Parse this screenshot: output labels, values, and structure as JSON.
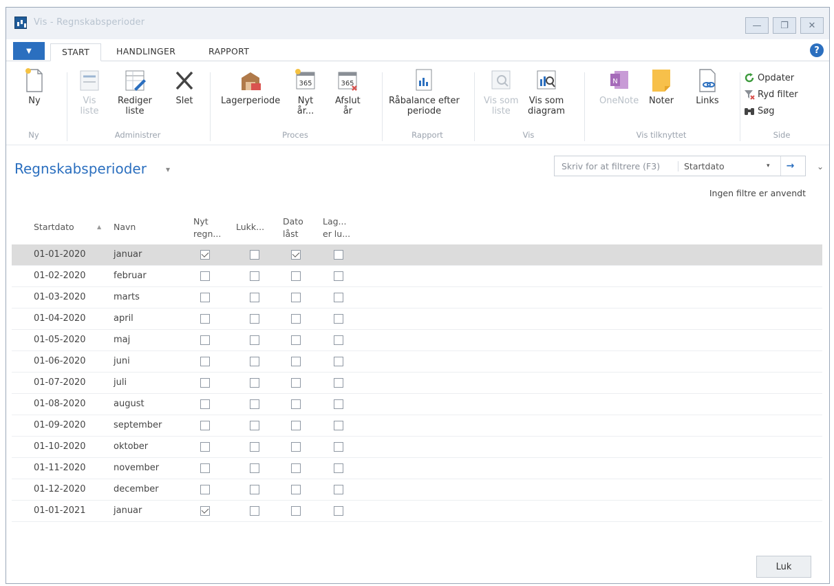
{
  "window": {
    "title": "Vis - Regnskabsperioder"
  },
  "win_controls": {
    "minimize": "—",
    "maximize": "❐",
    "close": "✕"
  },
  "ribbon_tabs": [
    "START",
    "HANDLINGER",
    "RAPPORT"
  ],
  "help_label": "?",
  "ribbon": {
    "groups": {
      "ny": "Ny",
      "administrer": "Administrer",
      "proces": "Proces",
      "rapport": "Rapport",
      "vis": "Vis",
      "vis_tilknyttet": "Vis tilknyttet",
      "side": "Side"
    },
    "buttons": {
      "ny": "Ny",
      "vis_liste_1": "Vis",
      "vis_liste_2": "liste",
      "rediger_1": "Rediger",
      "rediger_2": "liste",
      "slet": "Slet",
      "lagerperiode": "Lagerperiode",
      "nyt_aar_1": "Nyt",
      "nyt_aar_2": "år...",
      "afslut_1": "Afslut",
      "afslut_2": "år",
      "raabalance_1": "Råbalance efter",
      "raabalance_2": "periode",
      "vis_som_liste_1": "Vis som",
      "vis_som_liste_2": "liste",
      "vis_som_diagram_1": "Vis som",
      "vis_som_diagram_2": "diagram",
      "onenote": "OneNote",
      "noter": "Noter",
      "links": "Links",
      "opdater": "Opdater",
      "ryd_filter": "Ryd filter",
      "soeg": "Søg"
    },
    "icon_365": "365"
  },
  "page": {
    "title": "Regnskabsperioder",
    "title_caret": "▾",
    "filter_placeholder": "Skriv for at filtrere (F3)",
    "filter_field": "Startdato",
    "filter_drop": "▾",
    "filter_go": "→",
    "collapse": "⌄",
    "filter_status": "Ingen filtre er anvendt"
  },
  "table": {
    "headers": {
      "startdato": "Startdato",
      "navn": "Navn",
      "nyt_1": "Nyt",
      "nyt_2": "regn...",
      "lukk": "Lukk...",
      "dato_1": "Dato",
      "dato_2": "låst",
      "lag_1": "Lag...",
      "lag_2": "er lu..."
    },
    "sort_indicator": "▲",
    "rows": [
      {
        "startdato": "01-01-2020",
        "navn": "januar",
        "nyt": true,
        "lukk": false,
        "dato": true,
        "lag": false
      },
      {
        "startdato": "01-02-2020",
        "navn": "februar",
        "nyt": false,
        "lukk": false,
        "dato": false,
        "lag": false
      },
      {
        "startdato": "01-03-2020",
        "navn": "marts",
        "nyt": false,
        "lukk": false,
        "dato": false,
        "lag": false
      },
      {
        "startdato": "01-04-2020",
        "navn": "april",
        "nyt": false,
        "lukk": false,
        "dato": false,
        "lag": false
      },
      {
        "startdato": "01-05-2020",
        "navn": "maj",
        "nyt": false,
        "lukk": false,
        "dato": false,
        "lag": false
      },
      {
        "startdato": "01-06-2020",
        "navn": "juni",
        "nyt": false,
        "lukk": false,
        "dato": false,
        "lag": false
      },
      {
        "startdato": "01-07-2020",
        "navn": "juli",
        "nyt": false,
        "lukk": false,
        "dato": false,
        "lag": false
      },
      {
        "startdato": "01-08-2020",
        "navn": "august",
        "nyt": false,
        "lukk": false,
        "dato": false,
        "lag": false
      },
      {
        "startdato": "01-09-2020",
        "navn": "september",
        "nyt": false,
        "lukk": false,
        "dato": false,
        "lag": false
      },
      {
        "startdato": "01-10-2020",
        "navn": "oktober",
        "nyt": false,
        "lukk": false,
        "dato": false,
        "lag": false
      },
      {
        "startdato": "01-11-2020",
        "navn": "november",
        "nyt": false,
        "lukk": false,
        "dato": false,
        "lag": false
      },
      {
        "startdato": "01-12-2020",
        "navn": "december",
        "nyt": false,
        "lukk": false,
        "dato": false,
        "lag": false
      },
      {
        "startdato": "01-01-2021",
        "navn": "januar",
        "nyt": true,
        "lukk": false,
        "dato": false,
        "lag": false
      }
    ]
  },
  "footer": {
    "close_label": "Luk"
  },
  "colors": {
    "accent": "#2b6fbf",
    "selected_row": "#dcdcdc",
    "disabled_text": "#b9c0c8"
  }
}
